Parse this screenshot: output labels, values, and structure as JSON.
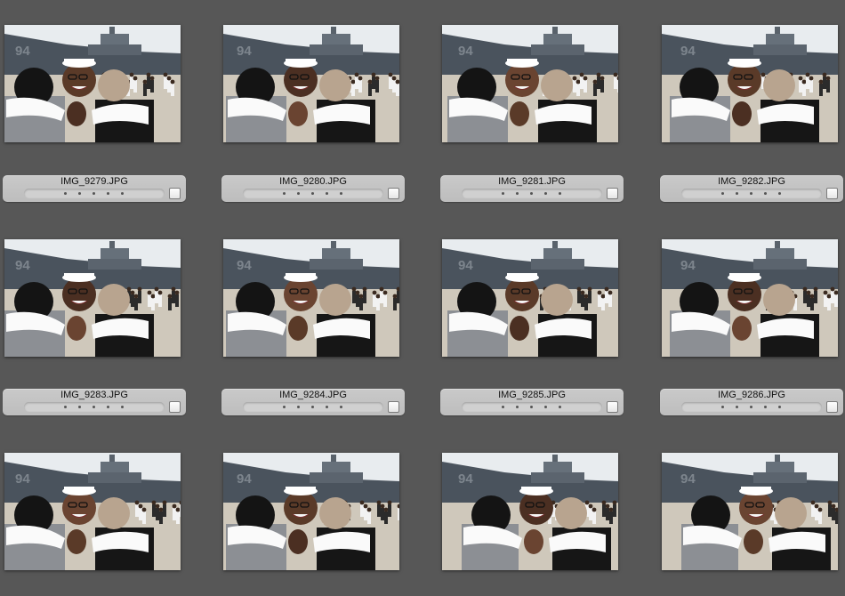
{
  "photos": [
    {
      "name": "IMG_9279.JPG",
      "rating_dots": 5
    },
    {
      "name": "IMG_9280.JPG",
      "rating_dots": 5
    },
    {
      "name": "IMG_9281.JPG",
      "rating_dots": 5
    },
    {
      "name": "IMG_9282.JPG",
      "rating_dots": 5
    },
    {
      "name": "IMG_9283.JPG",
      "rating_dots": 5
    },
    {
      "name": "IMG_9284.JPG",
      "rating_dots": 5
    },
    {
      "name": "IMG_9285.JPG",
      "rating_dots": 5
    },
    {
      "name": "IMG_9286.JPG",
      "rating_dots": 5
    },
    {
      "name": "",
      "rating_dots": 0
    },
    {
      "name": "",
      "rating_dots": 0
    },
    {
      "name": "",
      "rating_dots": 0
    },
    {
      "name": "",
      "rating_dots": 0
    }
  ],
  "colors": {
    "background": "#575757",
    "metadata_bar": "#c4c4c4",
    "sky": "#e8ecef",
    "ship_hull": "#4a535d",
    "ground": "#cfc8bb"
  }
}
